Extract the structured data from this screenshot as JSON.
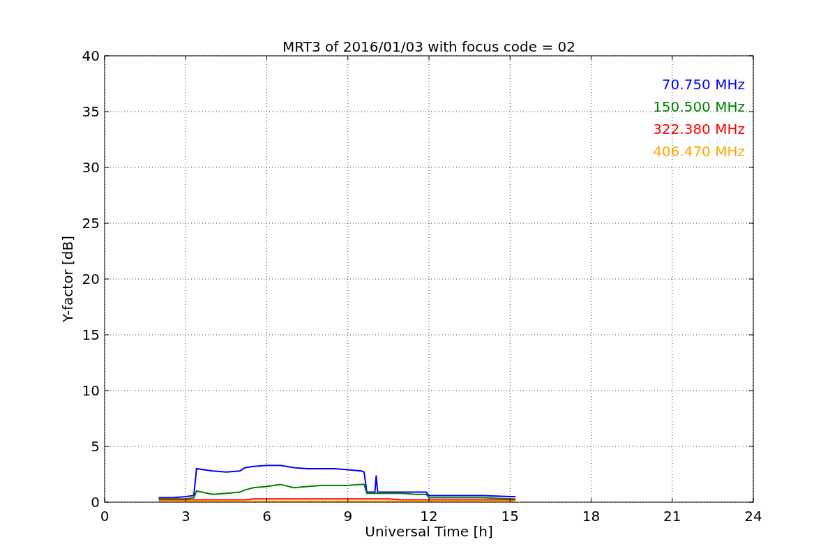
{
  "figure": {
    "chart_data": {
      "type": "line",
      "grid": true,
      "title": "MRT3 of 2016/01/03 with focus code = 02",
      "xlabel": "Universal Time [h]",
      "ylabel": "Y-factor [dB]",
      "xlim": [
        0,
        24
      ],
      "ylim": [
        0,
        40
      ],
      "xticks": [
        0,
        3,
        6,
        9,
        12,
        15,
        18,
        21,
        24
      ],
      "yticks": [
        0,
        5,
        10,
        15,
        20,
        25,
        30,
        35,
        40
      ],
      "x": [
        2,
        2.5,
        3,
        3.3,
        3.4,
        4,
        4.5,
        5,
        5.2,
        5.5,
        6,
        6.5,
        7,
        7.5,
        8,
        8.5,
        9,
        9.5,
        9.6,
        9.7,
        10,
        10.05,
        10.1,
        10.5,
        11,
        11.5,
        11.9,
        12,
        12.5,
        13,
        13.5,
        14,
        15,
        15.2
      ],
      "series": [
        {
          "name": "70.750 MHz",
          "color": "#0000ff",
          "values": [
            0.4,
            0.4,
            0.5,
            0.6,
            3.0,
            2.8,
            2.7,
            2.8,
            3.1,
            3.2,
            3.3,
            3.3,
            3.1,
            3.0,
            3.0,
            3.0,
            2.9,
            2.8,
            2.7,
            0.9,
            0.9,
            2.4,
            0.9,
            0.9,
            0.9,
            0.9,
            0.9,
            0.6,
            0.6,
            0.6,
            0.6,
            0.6,
            0.5,
            0.5
          ]
        },
        {
          "name": "150.500 MHz",
          "color": "#008000",
          "values": [
            0.3,
            0.3,
            0.3,
            0.4,
            1.0,
            0.7,
            0.8,
            0.9,
            1.1,
            1.3,
            1.4,
            1.6,
            1.3,
            1.4,
            1.5,
            1.5,
            1.5,
            1.6,
            1.6,
            0.8,
            0.8,
            0.8,
            0.8,
            0.8,
            0.8,
            0.7,
            0.7,
            0.4,
            0.4,
            0.4,
            0.4,
            0.4,
            0.3,
            0.3
          ]
        },
        {
          "name": "322.380 MHz",
          "color": "#ff0000",
          "values": [
            0.2,
            0.2,
            0.2,
            0.2,
            0.2,
            0.2,
            0.2,
            0.2,
            0.2,
            0.3,
            0.3,
            0.3,
            0.3,
            0.3,
            0.3,
            0.3,
            0.3,
            0.3,
            0.3,
            0.3,
            0.3,
            0.3,
            0.3,
            0.3,
            0.2,
            0.2,
            0.2,
            0.2,
            0.2,
            0.2,
            0.2,
            0.2,
            0.2,
            0.2
          ]
        },
        {
          "name": "406.470 MHz",
          "color": "#ffa500",
          "values": [
            0.1,
            0.1,
            0.1,
            0.1,
            0.1,
            0.1,
            0.1,
            0.1,
            0.1,
            0.1,
            0.1,
            0.1,
            0.1,
            0.1,
            0.1,
            0.1,
            0.1,
            0.1,
            0.1,
            0.1,
            0.1,
            0.1,
            0.1,
            0.1,
            0.1,
            0.1,
            0.1,
            0.1,
            0.1,
            0.1,
            0.1,
            0.1,
            0.1,
            0.1
          ]
        }
      ]
    }
  }
}
